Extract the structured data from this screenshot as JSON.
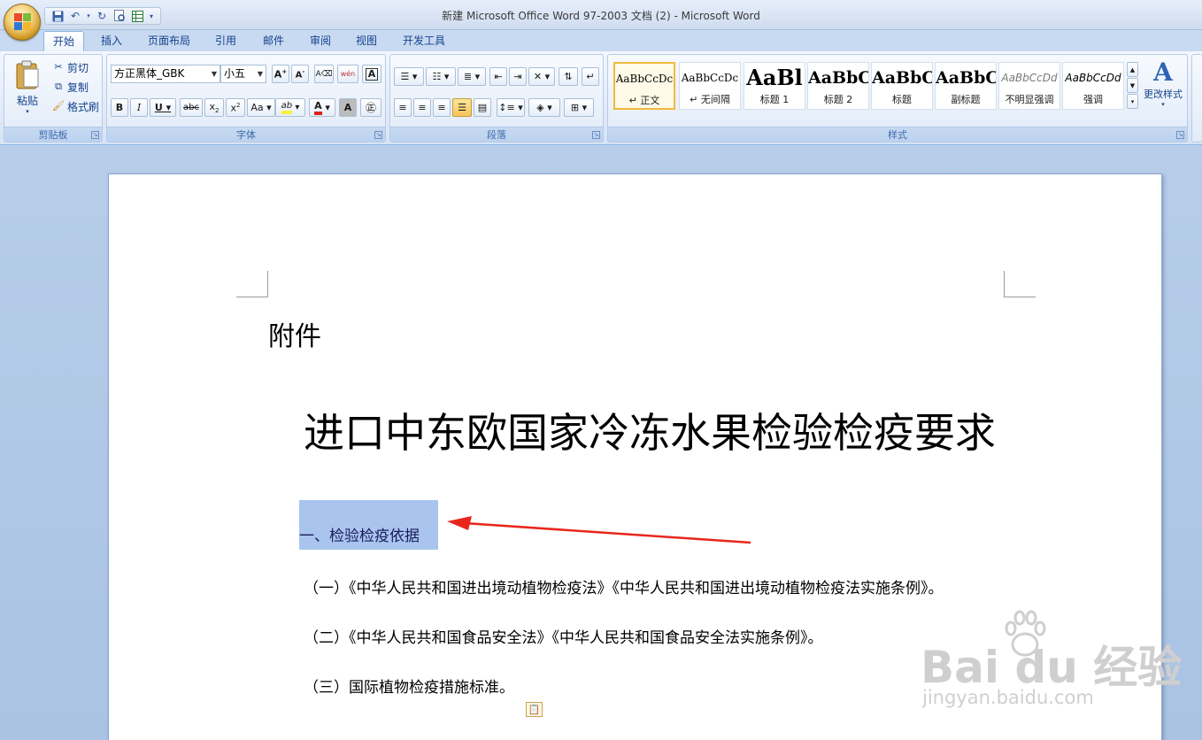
{
  "window": {
    "title": "新建 Microsoft Office Word 97-2003 文档 (2) - Microsoft Word"
  },
  "qat": {
    "icons": [
      "save-icon",
      "undo-icon",
      "redo-icon",
      "print-preview-icon",
      "spreadsheet-icon",
      "customize-icon"
    ]
  },
  "tabs": [
    {
      "label": "开始",
      "active": true
    },
    {
      "label": "插入"
    },
    {
      "label": "页面布局"
    },
    {
      "label": "引用"
    },
    {
      "label": "邮件"
    },
    {
      "label": "审阅"
    },
    {
      "label": "视图"
    },
    {
      "label": "开发工具"
    }
  ],
  "clipboard": {
    "paste_label": "粘贴",
    "cut_label": "剪切",
    "copy_label": "复制",
    "format_painter_label": "格式刷",
    "group_label": "剪贴板"
  },
  "font": {
    "font_name": "方正黑体_GBK",
    "font_size": "小五",
    "group_label": "字体",
    "accent_highlight": "#f3f33b",
    "accent_font_color": "#e0201b"
  },
  "paragraph": {
    "group_label": "段落"
  },
  "styles": {
    "group_label": "样式",
    "change_styles_label": "更改样式",
    "items": [
      {
        "sample": "AaBbCcDc",
        "name": "正文",
        "selected": true
      },
      {
        "sample": "AaBbCcDc",
        "name": "无间隔"
      },
      {
        "sample": "AaBl",
        "name": "标题 1"
      },
      {
        "sample": "AaBbC",
        "name": "标题 2"
      },
      {
        "sample": "AaBbC",
        "name": "标题"
      },
      {
        "sample": "AaBbC",
        "name": "副标题"
      },
      {
        "sample": "AaBbCcDd",
        "name": "不明显强调"
      },
      {
        "sample": "AaBbCcDd",
        "name": "强调"
      }
    ]
  },
  "document": {
    "attachment": "附件",
    "title": "进口中东欧国家冷冻水果检验检疫要求",
    "heading": "一、检验检疫依据",
    "paragraphs": [
      "（一）《中华人民共和国进出境动植物检疫法》《中华人民共和国进出境动植物检疫法实施条例》。",
      "（二）《中华人民共和国食品安全法》《中华人民共和国食品安全法实施条例》。",
      "（三）国际植物检疫措施标准。"
    ],
    "selection_color": "#a9c5ee",
    "arrow_color": "#e8261c"
  },
  "watermark": {
    "brand": "Bai du 经验",
    "url": "jingyan.baidu.com"
  }
}
